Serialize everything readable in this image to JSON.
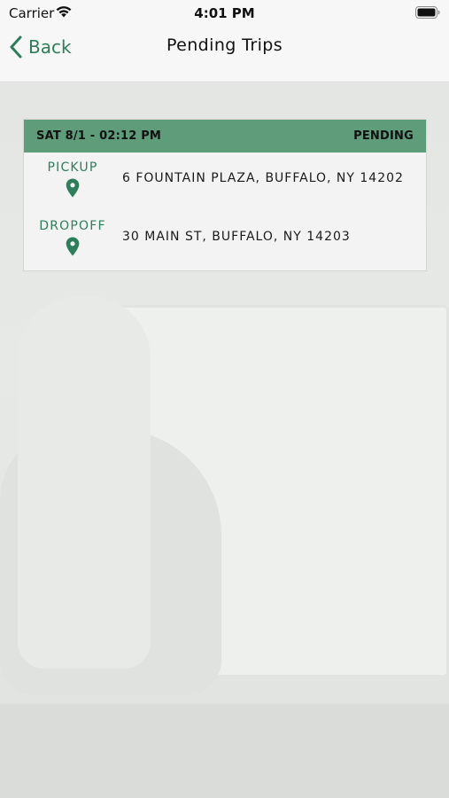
{
  "status_bar": {
    "carrier": "Carrier",
    "time": "4:01 PM",
    "wifi_icon": "wifi-icon",
    "battery_icon": "battery-icon"
  },
  "nav": {
    "back_label": "Back",
    "back_icon": "chevron-left-icon",
    "title": "Pending Trips"
  },
  "colors": {
    "accent": "#2e7d5b",
    "header_bg": "#5f9c79"
  },
  "trips": [
    {
      "datetime": "SAT 8/1 - 02:12 PM",
      "status": "PENDING",
      "pickup": {
        "label": "PICKUP",
        "icon": "map-pin-icon",
        "address": "6 FOUNTAIN PLAZA, BUFFALO, NY 14202"
      },
      "dropoff": {
        "label": "DROPOFF",
        "icon": "map-pin-icon",
        "address": "30 MAIN ST, BUFFALO, NY 14203"
      }
    }
  ]
}
